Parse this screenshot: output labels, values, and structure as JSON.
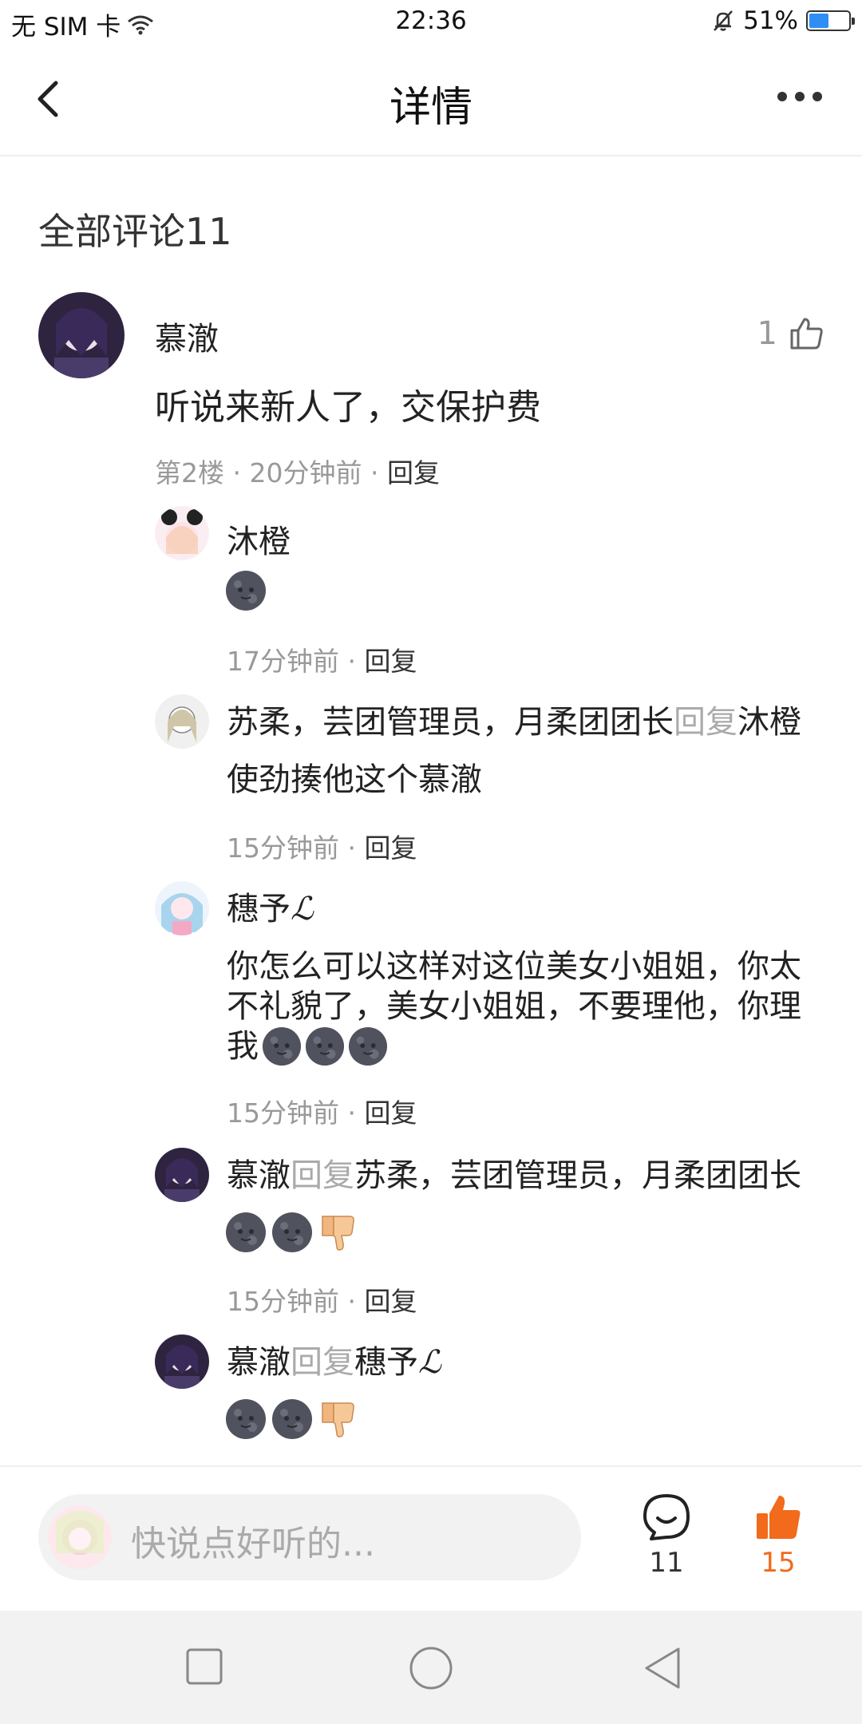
{
  "status": {
    "carrier": "无 SIM 卡",
    "time": "22:36",
    "battery": "51%",
    "battery_level": 0.51
  },
  "nav": {
    "title": "详情"
  },
  "section": {
    "title": "全部评论11"
  },
  "main_comment": {
    "user": "慕澈",
    "text": "听说来新人了，交保护费",
    "floor": "第2楼",
    "time": "20分钟前",
    "reply_label": "回复",
    "likes": "1"
  },
  "replies": [
    {
      "user": "沐橙",
      "text": "",
      "time": "17分钟前",
      "reply_label": "回复"
    },
    {
      "user": "苏柔，芸团管理员，月柔团团长",
      "reply_word": "回复",
      "target": "沐橙",
      "text": "使劲揍他这个慕澈",
      "time": "15分钟前",
      "reply_label": "回复"
    },
    {
      "user": "穗予",
      "signature": "ℒ",
      "text_lines": [
        "你怎么可以这样对这位美女小姐姐，你太",
        "不礼貌了，美女小姐姐，不要理他，你理",
        "我"
      ],
      "time": "15分钟前",
      "reply_label": "回复"
    },
    {
      "user": "慕澈",
      "reply_word": "回复",
      "target": "苏柔，芸团管理员，月柔团团长",
      "time": "15分钟前",
      "reply_label": "回复"
    },
    {
      "user": "慕澈",
      "reply_word": "回复",
      "target": "穗予"
    }
  ],
  "bottom": {
    "placeholder": "快说点好听的...",
    "comment_count": "11",
    "like_count": "15"
  },
  "colors": {
    "accent": "#f26a1b",
    "battery": "#2f8ef4"
  },
  "icons": [
    "back-arrow-icon",
    "more-icon",
    "thumb-up-icon",
    "comment-icon",
    "moon-emoji",
    "thumb-down-emoji"
  ]
}
